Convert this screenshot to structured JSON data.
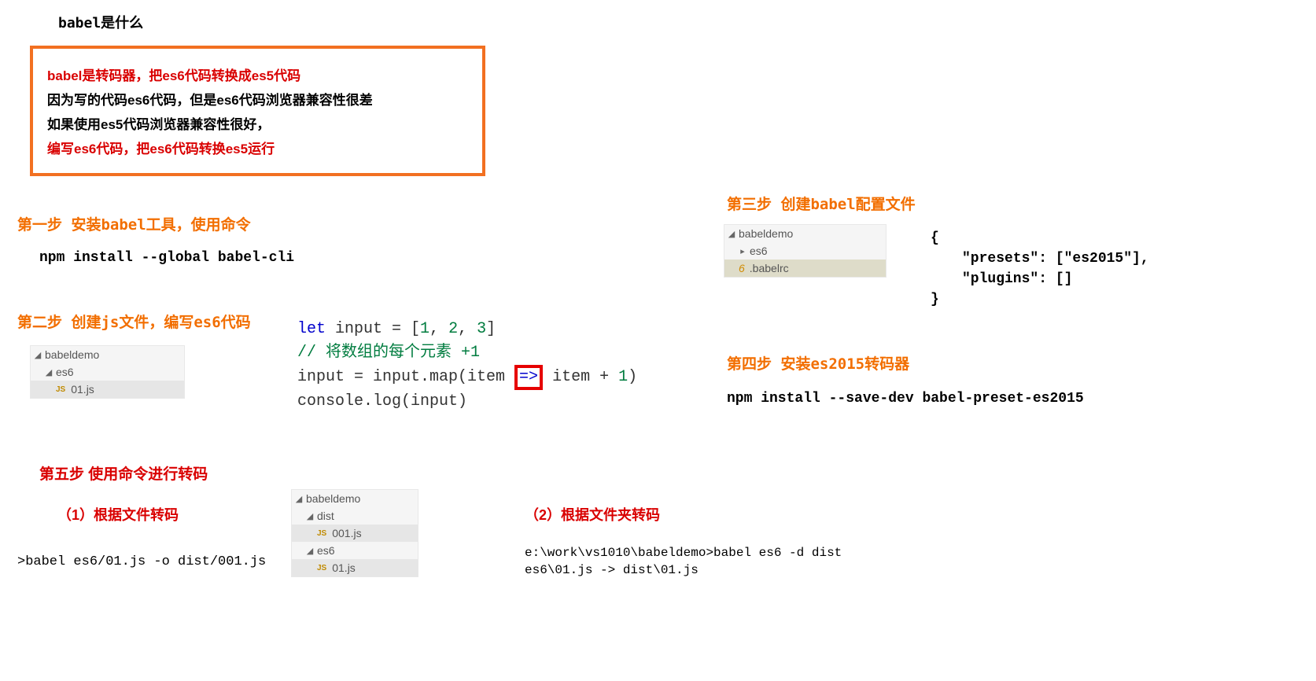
{
  "title": "babel是什么",
  "box": {
    "line1": "babel是转码器，把es6代码转换成es5代码",
    "line2": "因为写的代码es6代码，但是es6代码浏览器兼容性很差",
    "line3": "如果使用es5代码浏览器兼容性很好，",
    "line4": "编写es6代码，把es6代码转换es5运行"
  },
  "step1": {
    "heading": "第一步 安装babel工具，使用命令",
    "cmd": "npm install --global babel-cli"
  },
  "step2": {
    "heading": "第二步 创建js文件，编写es6代码",
    "tree": {
      "root": "babeldemo",
      "folder1": "es6",
      "file1": "01.js"
    },
    "code": {
      "l1a": "let",
      "l1b": " input = [",
      "l1c": "1",
      "l1d": ", ",
      "l1e": "2",
      "l1f": ", ",
      "l1g": "3",
      "l1h": "]",
      "l2": "// 将数组的每个元素 +1",
      "l3a": "input = input.map(item ",
      "l3b": "=>",
      "l3c": " item + ",
      "l3d": "1",
      "l3e": ")",
      "l4": "console.log(input)"
    }
  },
  "step3": {
    "heading": "第三步 创建babel配置文件",
    "tree": {
      "root": "babeldemo",
      "folder1": "es6",
      "file1": ".babelrc"
    },
    "json": {
      "l1": "{",
      "l2": "\"presets\": [\"es2015\"],",
      "l3": "\"plugins\": []",
      "l4": "}"
    }
  },
  "step4": {
    "heading": "第四步 安装es2015转码器",
    "cmd": "npm install --save-dev babel-preset-es2015"
  },
  "step5": {
    "heading": "第五步 使用命令进行转码",
    "sub1": "（1）根据文件转码",
    "sub2": "（2）根据文件夹转码",
    "cmd1": ">babel es6/01.js -o dist/001.js",
    "tree": {
      "root": "babeldemo",
      "folder1": "dist",
      "file1": "001.js",
      "folder2": "es6",
      "file2": "01.js"
    },
    "term": {
      "l1": "e:\\work\\vs1010\\babeldemo>babel es6 -d dist",
      "l2": "es6\\01.js -> dist\\01.js"
    }
  }
}
